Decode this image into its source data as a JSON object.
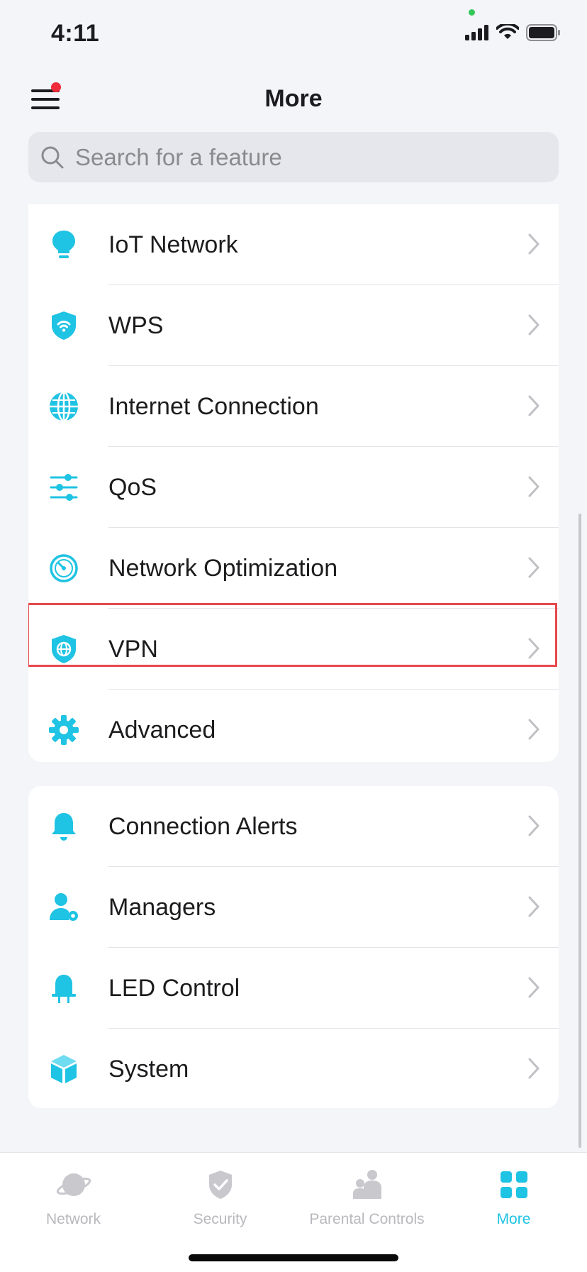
{
  "status_bar": {
    "time": "4:11",
    "icons": [
      "signal-icon",
      "wifi-icon",
      "battery-icon"
    ]
  },
  "header": {
    "title": "More",
    "menu_icon": "hamburger-menu-icon",
    "notification_dot_color": "#ee2a3b"
  },
  "search": {
    "placeholder": "Search for a feature",
    "icon": "search-icon"
  },
  "sections": [
    {
      "items": [
        {
          "label": "IoT Network",
          "icon": "lightbulb-icon"
        },
        {
          "label": "WPS",
          "icon": "wifi-shield-icon"
        },
        {
          "label": "Internet Connection",
          "icon": "globe-icon"
        },
        {
          "label": "QoS",
          "icon": "sliders-icon"
        },
        {
          "label": "Network Optimization",
          "icon": "speedometer-icon"
        },
        {
          "label": "VPN",
          "icon": "vpn-shield-icon",
          "highlighted": true
        },
        {
          "label": "Advanced",
          "icon": "gear-icon"
        }
      ]
    },
    {
      "items": [
        {
          "label": "Connection Alerts",
          "icon": "bell-icon"
        },
        {
          "label": "Managers",
          "icon": "user-gear-icon"
        },
        {
          "label": "LED Control",
          "icon": "led-icon"
        },
        {
          "label": "System",
          "icon": "cube-icon"
        }
      ]
    }
  ],
  "tab_bar": {
    "tabs": [
      {
        "label": "Network",
        "icon": "planet-icon",
        "active": false
      },
      {
        "label": "Security",
        "icon": "shield-check-icon",
        "active": false
      },
      {
        "label": "Parental Controls",
        "icon": "family-icon",
        "active": false
      },
      {
        "label": "More",
        "icon": "grid-icon",
        "active": true
      }
    ]
  },
  "colors": {
    "accent": "#1fc3e3",
    "highlight_border": "#e5484d",
    "background": "#f4f5f9",
    "inactive_tab": "#b8b8bd"
  }
}
